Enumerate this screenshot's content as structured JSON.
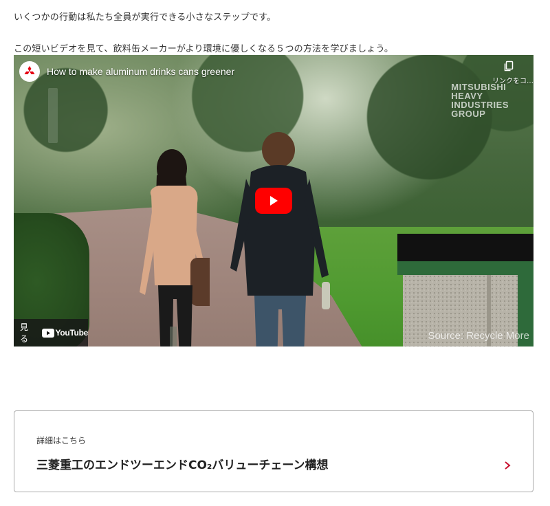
{
  "intro": {
    "paragraph1": "いくつかの行動は私たち全員が実行できる小さなステップです。",
    "paragraph2": "この短いビデオを見て、飲料缶メーカーがより環境に優しくなる５つの方法を学びましょう。"
  },
  "video": {
    "title": "How to make aluminum drinks cans greener",
    "copy_link_label": "リンクをコ…",
    "watermark_lines": [
      "MITSUBISHI",
      "HEAVY",
      "INDUSTRIES",
      "GROUP"
    ],
    "watch_on_label": "見る",
    "youtube_label": "YouTube",
    "source_credit": "Source: Recycle More",
    "colors": {
      "play_button": "#ff0000"
    },
    "icons": [
      "mitsubishi-logo",
      "copy-icon",
      "play-icon",
      "youtube-icon"
    ]
  },
  "card": {
    "eyebrow": "詳細はこちら",
    "title": "三菱重工のエンドツーエンドCO₂バリューチェーン構想",
    "colors": {
      "chevron": "#c8102e"
    },
    "icon": "chevron-right-icon"
  }
}
